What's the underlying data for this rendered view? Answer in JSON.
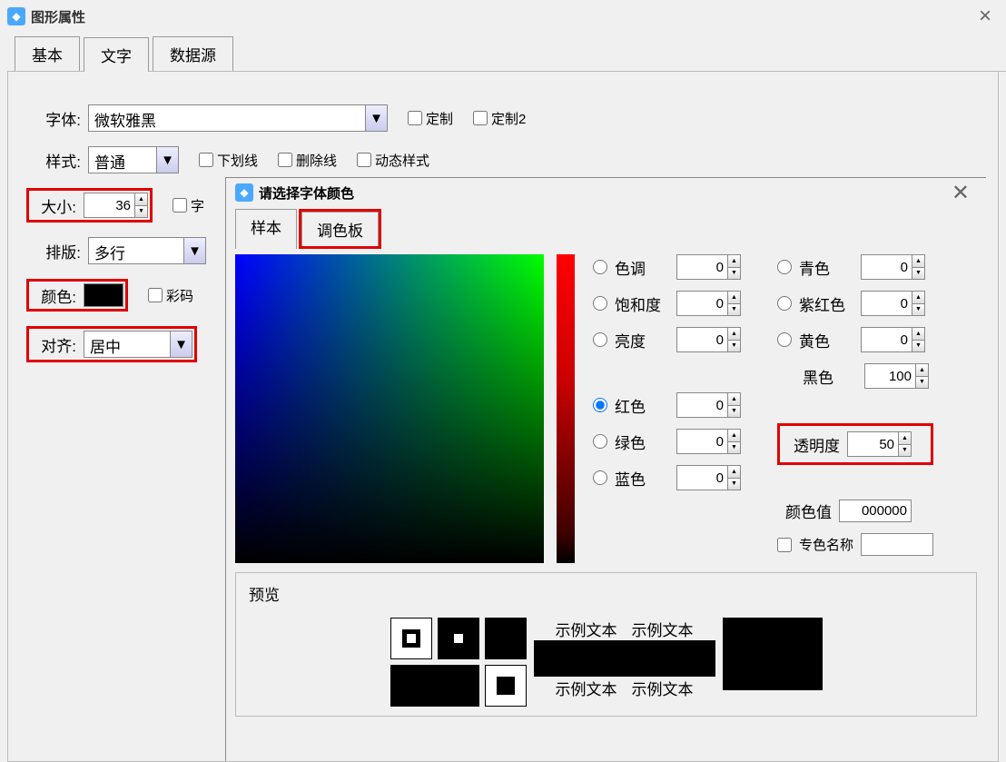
{
  "main": {
    "title": "图形属性",
    "tabs": {
      "basic": "基本",
      "text": "文字",
      "datasource": "数据源"
    },
    "form": {
      "font_label": "字体:",
      "font_value": "微软雅黑",
      "custom1": "定制",
      "custom2": "定制2",
      "style_label": "样式:",
      "style_value": "普通",
      "underline": "下划线",
      "strike": "删除线",
      "dynstyle": "动态样式",
      "size_label": "大小:",
      "size_value": "36",
      "charspacing": "字",
      "layout_label": "排版:",
      "layout_value": "多行",
      "color_label": "颜色:",
      "colorcode_cb": "彩码",
      "align_label": "对齐:",
      "align_value": "居中"
    }
  },
  "picker": {
    "title": "请选择字体颜色",
    "tabs": {
      "sample": "样本",
      "palette": "调色板"
    },
    "hue": "色调",
    "hue_v": "0",
    "sat": "饱和度",
    "sat_v": "0",
    "lum": "亮度",
    "lum_v": "0",
    "red": "红色",
    "red_v": "0",
    "green": "绿色",
    "green_v": "0",
    "blue": "蓝色",
    "blue_v": "0",
    "cyan": "青色",
    "cyan_v": "0",
    "magenta": "紫红色",
    "magenta_v": "0",
    "yellow": "黄色",
    "yellow_v": "0",
    "black": "黑色",
    "black_v": "100",
    "alpha": "透明度",
    "alpha_v": "50",
    "colorval_label": "颜色值",
    "colorval": "000000",
    "spot_label": "专色名称",
    "preview_label": "预览",
    "sample_text": "示例文本"
  }
}
